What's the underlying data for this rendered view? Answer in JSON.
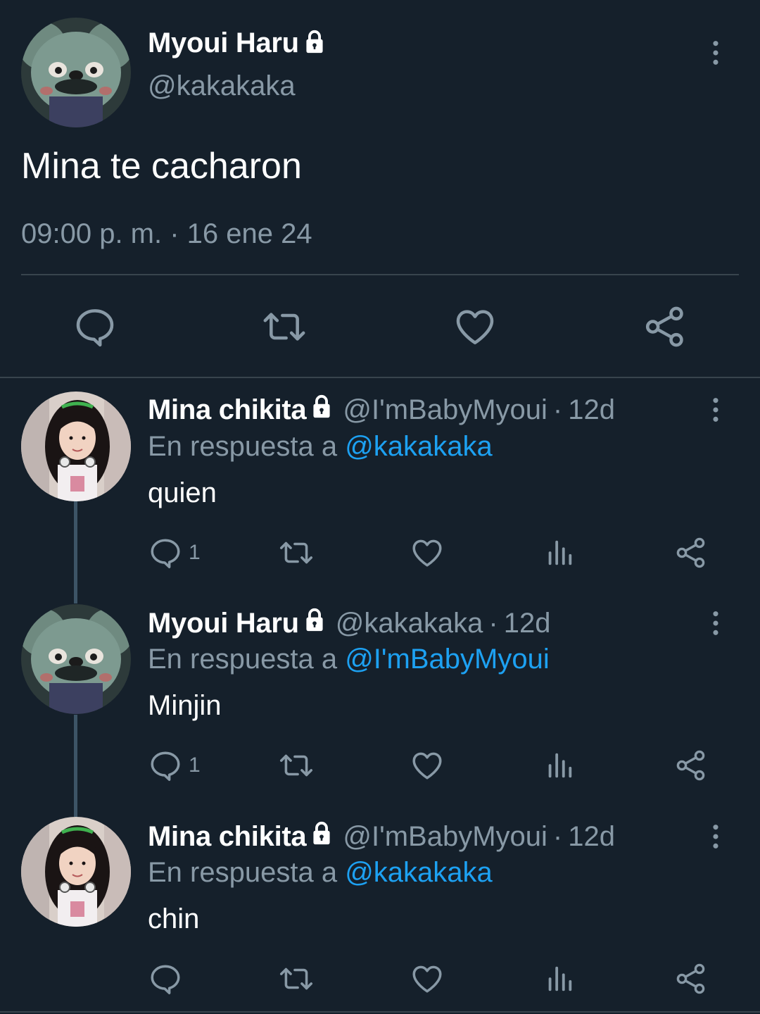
{
  "main_tweet": {
    "author_name": "Myoui Haru",
    "author_handle": "@kakakaka",
    "text": "Mina te cacharon",
    "timestamp": "09:00 p. m. · 16 ene 24",
    "protected": true
  },
  "replies": [
    {
      "author_name": "Mina chikita",
      "author_handle": "@I'mBabyMyoui",
      "age": "12d",
      "reply_to_prefix": "En respuesta a",
      "reply_to_handle": "@kakakaka",
      "text": "quien",
      "reply_count": "1",
      "protected": true
    },
    {
      "author_name": "Myoui Haru",
      "author_handle": "@kakakaka",
      "age": "12d",
      "reply_to_prefix": "En respuesta a",
      "reply_to_handle": "@I'mBabyMyoui",
      "text": "Minjin",
      "reply_count": "1",
      "protected": true
    },
    {
      "author_name": "Mina chikita",
      "author_handle": "@I'mBabyMyoui",
      "age": "12d",
      "reply_to_prefix": "En respuesta a",
      "reply_to_handle": "@kakakaka",
      "text": "chin",
      "reply_count": "",
      "protected": true
    }
  ],
  "separator": "·",
  "icons": {
    "reply": "reply-icon",
    "retweet": "retweet-icon",
    "like": "like-icon",
    "share": "share-icon",
    "analytics": "analytics-icon",
    "more": "more-icon",
    "lock": "lock-icon"
  },
  "colors": {
    "background": "#15202b",
    "primary_text": "#ffffff",
    "secondary_text": "#8899a6",
    "link": "#1da1f2",
    "divider": "#38444d"
  }
}
